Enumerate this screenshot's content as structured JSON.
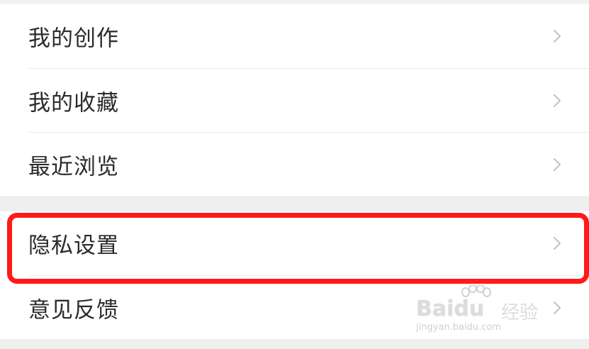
{
  "menu_group_1": [
    {
      "label": "我的创作"
    },
    {
      "label": "我的收藏"
    },
    {
      "label": "最近浏览"
    }
  ],
  "menu_group_2": [
    {
      "label": "隐私设置",
      "highlighted": true
    },
    {
      "label": "意见反馈"
    }
  ],
  "highlight_color": "#ff1a1a",
  "watermark": {
    "main": "Baidu",
    "cn": "经验",
    "url": "jingyan.baidu.com"
  },
  "icons": {
    "row_arrow": "chevron-right-icon"
  }
}
